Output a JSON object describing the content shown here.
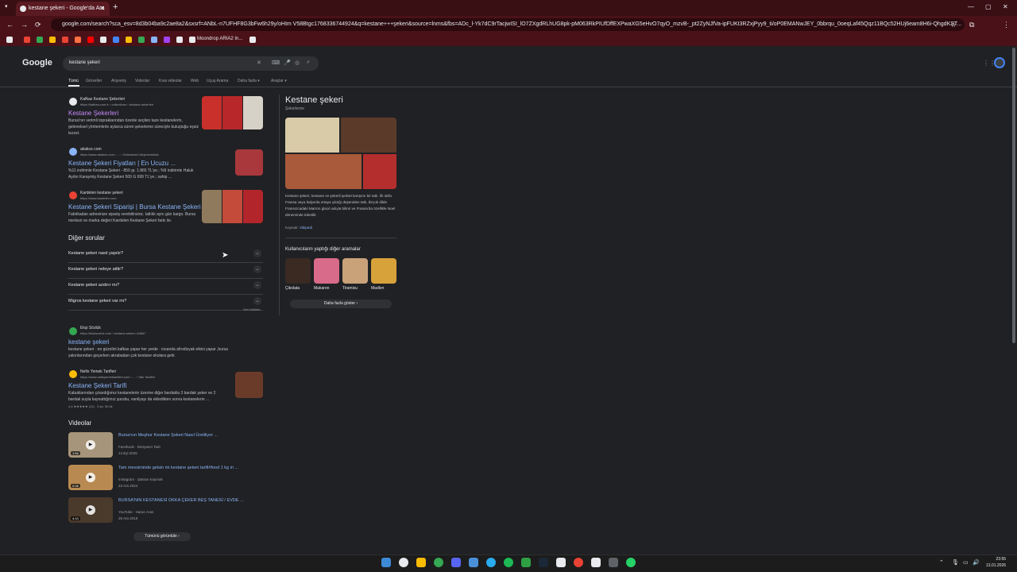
{
  "browser": {
    "tab_title": "kestane şekeri - Google'da Ara",
    "tab_close": "✕",
    "new_tab": "+",
    "tab_menu": "▾",
    "url": "google.com/search?sca_esv=8d3b04ba9c2ae8a2&sxsrf=ANbL-n7UFHF8G3bFw6h29y/oHIm V58Btgc1768336744924&q=kestane+++şekeri&source=lnms&fbs=ADc_l-Yk7dC9rTacjwISI_lO7ZXgdRLhUG8pk-pM063RkPIUfDffEXPwaXG5eHvO7qyO_mzvB-_pt2ZyNJfVa-ipFUKt3RZxjPyy9_ti/oP0EMANwJEY_0bbrqu_0oeqLaf45Qqz11BQc52HUj6eam8H6i-QhgdKST...",
    "bookmark_label": "Moondrop ARIA2 In...",
    "nav": {
      "back": "←",
      "forward": "→",
      "reload": "⟳"
    },
    "window": {
      "min": "—",
      "max": "▢",
      "close": "✕"
    }
  },
  "google": {
    "logo": "Google",
    "query": "kestane şekeri",
    "clear": "✕",
    "tabs": [
      "Tümü",
      "Görseller",
      "Alışveriş",
      "Videolar",
      "Kısa videolar",
      "Web",
      "Uçuş Arama",
      "Daha fazla ▾",
      "Araçlar ▾"
    ]
  },
  "results": [
    {
      "site": "Kafkas Kestane Şekerleri",
      "url": "https://kafkas.com.tr › collections › kestane-sekerleri",
      "title": "Kestane Şekerleri",
      "snippet": "Bursa'nın verimli topraklarından özenle seçilen taze kestanelerin, geleneksel yöntemlerle aylarca süren şekerleme süreciyle buluştuğu eşsiz lezzet."
    },
    {
      "site": "akakce.com",
      "url": "https://www.akakce.com › ... › Gelenekseİ Atıştırmalıklar",
      "title": "Kestane Şekeri Fiyatları | En Ucuzu ...",
      "snippet": "%11 indirimle Kestane Şekeri - 850 gr. 1.865 TL'ye.; %9 indirimle Haluk Aydın Karaymiş Kestane Şekeri 500 G 699 TL'ye.; sahip ..."
    },
    {
      "site": "Kardelen kestane şekeri",
      "url": "https://www.kardelen.com",
      "title": "Kestane Şekeri Siparişi | Bursa Kestane Şekeri Al",
      "snippet": "Fabrikadan adresinize sipariş verebilirsiniz. tatlılık aynı gün kargo. Bursa merkezi ve marka değeri Kardelen Kestane Şekeri farkı ile."
    }
  ],
  "paa": {
    "heading": "Diğer sorular",
    "questions": [
      "Kestane şekeri nasıl yapılır?",
      "Kestane şekeri neleye aittir?",
      "Kestane şekeri azdırır mı?",
      "Migros kestane şekeri var mı?"
    ],
    "feedback": "Geri bildirim"
  },
  "results2": [
    {
      "site": "Ekşi Sözlük",
      "url": "https://eksisozluk.com › kestane-sekeri--84687",
      "title": "kestane şekeri",
      "snippet": "kestane şekeri · en güzelini kafkas yapar her yerde · insanda afrodizyak etkisi yapar ,bursa yakınlarından geçerken akrabadan çok kestane ekolara gelir."
    },
    {
      "site": "Nefis Yemek Tarifleri",
      "url": "https://www.nefisyemektarifleri.com › ... › Tatlı Tarifleri",
      "title": "Kestane Şekeri Tarifi",
      "snippet": "Kabuklarından çıkardığımız kestanelerin üzerine diğer bardakla 3 bardak şeker ve 2 bardak suyla kaynattığımız şurubu, vanilyayı da ekledikten sonra kestanelerin ...",
      "rating": "4,4 ★★★★★ (11) · 3 sa. 30 dk"
    }
  ],
  "videos": {
    "heading": "Videolar",
    "items": [
      {
        "title": "Bursa'nın Meşhur Kestane Şekeri Nasıl Üretiliyor ...",
        "source": "Facebook · Dünyanın Tadı",
        "date": "14 Eyl 2025",
        "duration": "1:54"
      },
      {
        "title": "Tam mevsiminde gelsin mi kestane şekeri tarifi#food 1 kg iri ...",
        "source": "Instagram · Şükran Kaymak",
        "date": "23 Ara 2024",
        "duration": "0:26"
      },
      {
        "title": "BURSA'NIN KESTANESİ OKKA ÇEKER BEŞ TANESİ / EVDE ...",
        "source": "YouTube · Harun Aras",
        "date": "26 Ara 2019",
        "duration": "4:13"
      }
    ],
    "view_all": "Tümünü görüntüle ›"
  },
  "knowledge_panel": {
    "title": "Kestane şekeri",
    "subtitle": "Şekerleme",
    "description": "Kestane şekeri, kestane ve şekerli şerbet karışımı bir tatlı. İlk defa Fransa veya İtalya'da ortaya çıktığı düşünülen tatlı, birçok dilde Fransızcadaki Marron glacé adıyla bilinir ve Fransa'da özellikle Noel döneminde tüketilir.",
    "source_label": "Kaynak:",
    "source": "Vikipedi",
    "related_heading": "Kullanıcıların yaptığı diğer aramalar",
    "related": [
      "Çikolata",
      "Makaron",
      "Tiramisu",
      "Madlen"
    ],
    "more": "Daha fazla göster ›"
  },
  "taskbar": {
    "time": "23:55",
    "date": "13.01.2026"
  },
  "colors": {
    "accent": "#8ab4f8",
    "visited": "#c58af9",
    "bg": "#202124",
    "chrome": "#4a1218"
  }
}
